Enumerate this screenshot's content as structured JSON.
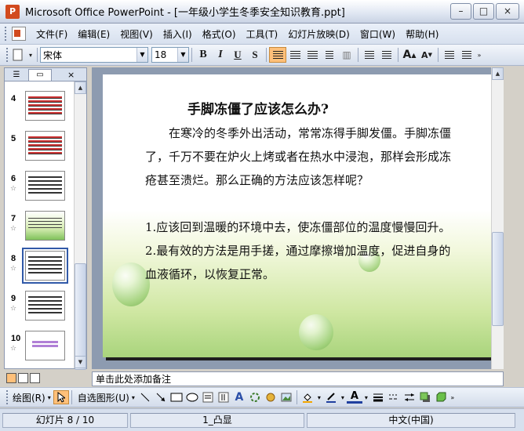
{
  "window": {
    "title": "Microsoft Office PowerPoint - [一年级小学生冬季安全知识教育.ppt]",
    "buttons": [
      "–",
      "□",
      "×"
    ]
  },
  "menu": {
    "items": [
      "文件(F)",
      "编辑(E)",
      "视图(V)",
      "插入(I)",
      "格式(O)",
      "工具(T)",
      "幻灯片放映(D)",
      "窗口(W)",
      "帮助(H)"
    ]
  },
  "toolbar": {
    "font_name": "宋体",
    "font_size": "18",
    "bold": "B",
    "italic": "I",
    "underline": "U",
    "shadow": "S",
    "grow_font": "A",
    "shrink_font": "A"
  },
  "panel": {
    "tabs": [
      "outline-tab",
      "slides-tab"
    ],
    "close": "×",
    "thumbnails": [
      {
        "num": "4",
        "style": "red",
        "star": ""
      },
      {
        "num": "5",
        "style": "red",
        "star": ""
      },
      {
        "num": "6",
        "style": "plain",
        "star": "☆"
      },
      {
        "num": "7",
        "style": "green",
        "star": "☆"
      },
      {
        "num": "8",
        "style": "plain",
        "star": "☆",
        "selected": true
      },
      {
        "num": "9",
        "style": "plain",
        "star": "☆"
      },
      {
        "num": "10",
        "style": "purple",
        "star": "☆"
      }
    ]
  },
  "slide": {
    "title": "手脚冻僵了应该怎么办?",
    "intro": "在寒冷的冬季外出活动，常常冻得手脚发僵。手脚冻僵了，千万不要在炉火上烤或者在热水中浸泡，那样会形成冻疮甚至溃烂。那么正确的方法应该怎样呢？",
    "point1": "1.应该回到温暖的环境中去，使冻僵部位的温度慢慢回升。",
    "point2": "2.最有效的方法是用手搓，通过摩擦增加温度，促进自身的血液循环，以恢复正常。"
  },
  "notes": {
    "placeholder": "单击此处添加备注"
  },
  "drawbar": {
    "draw_label": "绘图(R)",
    "autoshapes_label": "自选图形(U)"
  },
  "status": {
    "slide": "幻灯片 8 / 10",
    "design": "1_凸显",
    "language": "中文(中国)"
  }
}
